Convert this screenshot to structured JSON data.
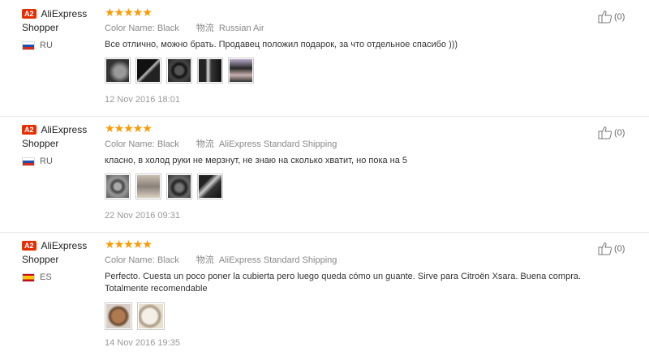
{
  "reviews": [
    {
      "badge": "A2",
      "user_line1": "AliExpress",
      "user_line2": "Shopper",
      "country": "RU",
      "stars": "★★★★★",
      "color_label": "Color Name:",
      "color_value": "Black",
      "logistics_label": "物流",
      "logistics_value": "Russian Air",
      "text": "Все отлично, можно брать. Продавец положил подарок, за что отдельное спасибо )))",
      "images": 5,
      "date": "12 Nov 2016 18:01",
      "likes": "(0)"
    },
    {
      "badge": "A2",
      "user_line1": "AliExpress",
      "user_line2": "Shopper",
      "country": "RU",
      "stars": "★★★★★",
      "color_label": "Color Name:",
      "color_value": "Black",
      "logistics_label": "物流",
      "logistics_value": "AliExpress Standard Shipping",
      "text": "класно, в холод руки не мерзнут, не знаю на сколько хватит, но пока на 5",
      "images": 4,
      "date": "22 Nov 2016 09:31",
      "likes": "(0)"
    },
    {
      "badge": "A2",
      "user_line1": "AliExpress",
      "user_line2": "Shopper",
      "country": "ES",
      "stars": "★★★★★",
      "color_label": "Color Name:",
      "color_value": "Black",
      "logistics_label": "物流",
      "logistics_value": "AliExpress Standard Shipping",
      "text": "Perfecto. Cuesta un poco poner la cubierta pero luego queda cómo un guante. Sirve para Citroën Xsara. Buena compra. Totalmente recomendable",
      "images": 2,
      "date": "14 Nov 2016 19:35",
      "likes": "(0)"
    }
  ]
}
